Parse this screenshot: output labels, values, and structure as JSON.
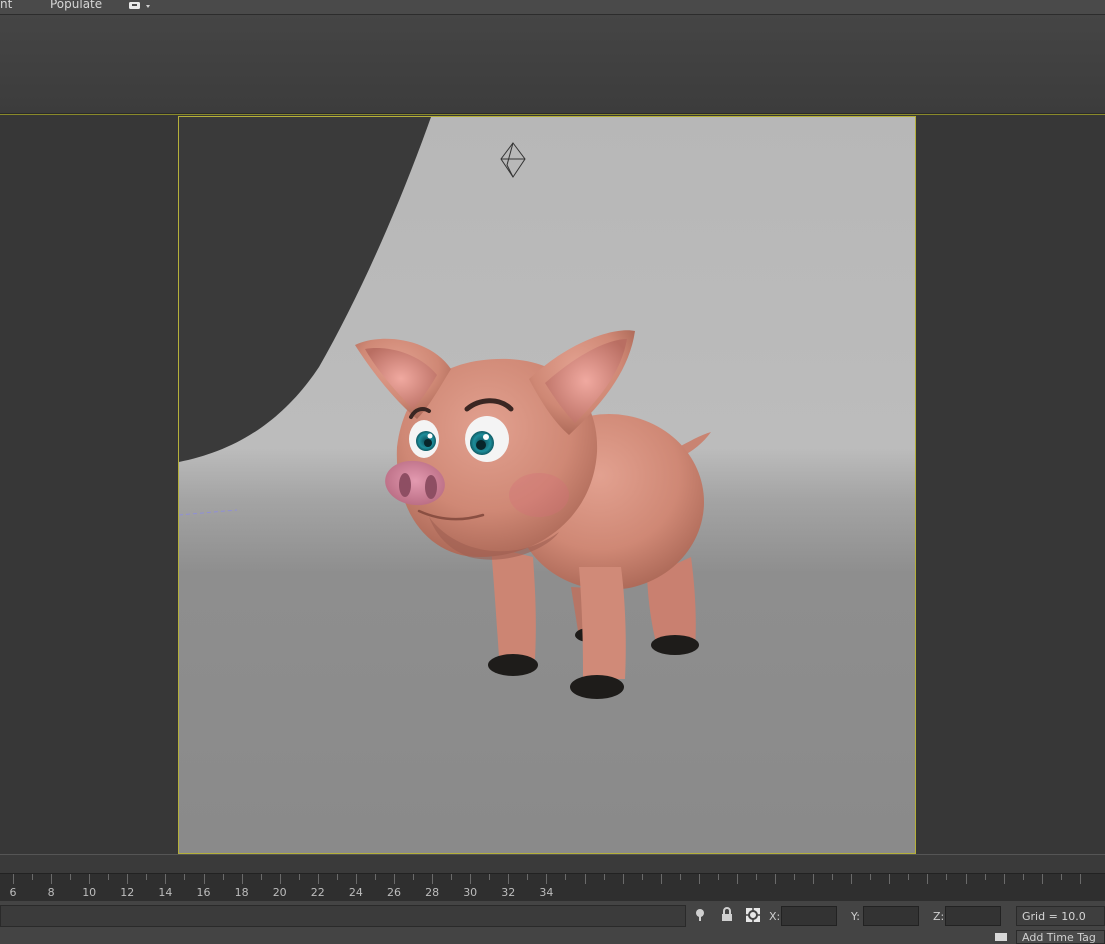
{
  "menu": {
    "partial_item": "nt",
    "populate": "Populate"
  },
  "viewport": {
    "scene": "cartoon pig"
  },
  "timeline": {
    "ticks": [
      "6",
      "8",
      "10",
      "12",
      "14",
      "16",
      "18",
      "20",
      "22",
      "24",
      "26",
      "28",
      "30",
      "32",
      "34"
    ]
  },
  "status": {
    "x_label": "X:",
    "y_label": "Y:",
    "z_label": "Z:",
    "grid": "Grid = 10.0",
    "add_time_tag": "Add Time Tag"
  },
  "colors": {
    "safe_frame": "#b5b03a",
    "pig_skin": "#d58f7c",
    "hooves": "#1e1c1a"
  }
}
